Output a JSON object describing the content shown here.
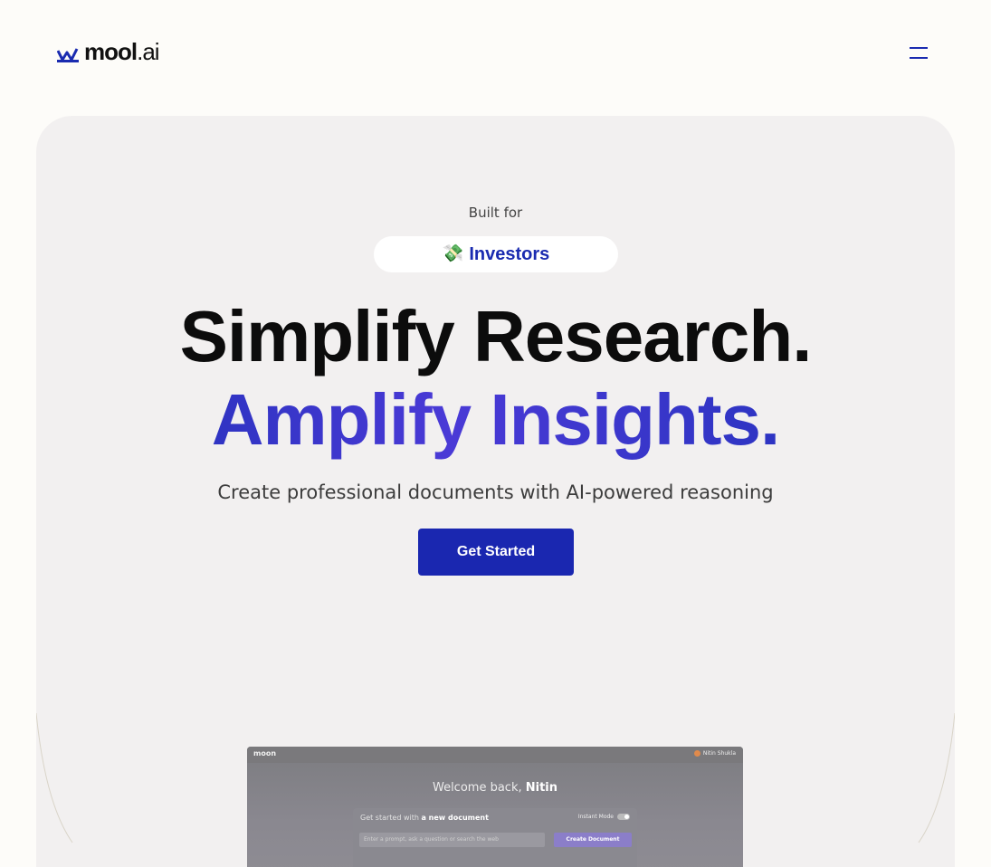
{
  "nav": {
    "logo_word": "mool",
    "logo_suffix": ".ai",
    "menu_icon": "hamburger-menu-icon"
  },
  "hero": {
    "built_for_label": "Built for",
    "audience_icon": "💸",
    "audience_label": "Investors",
    "headline_line1": "Simplify Research.",
    "headline_line2": "Amplify Insights.",
    "subtitle": "Create professional documents with AI-powered reasoning",
    "cta_label": "Get Started"
  },
  "preview": {
    "brand": "moon",
    "user_name": "Nitin Shukla",
    "welcome_prefix": "Welcome back,",
    "welcome_name": "Nitin",
    "get_started_prefix": "Get started with",
    "get_started_strong": "a new document",
    "instant_mode_label": "Instant Mode",
    "input_placeholder": "Enter a prompt, ask a question or search the web",
    "create_button": "Create Document"
  },
  "colors": {
    "page_bg": "#fdfcf9",
    "hero_bg": "#f2f0f0",
    "brand_blue": "#1a27b0",
    "headline_dark": "#0c0c0c"
  }
}
